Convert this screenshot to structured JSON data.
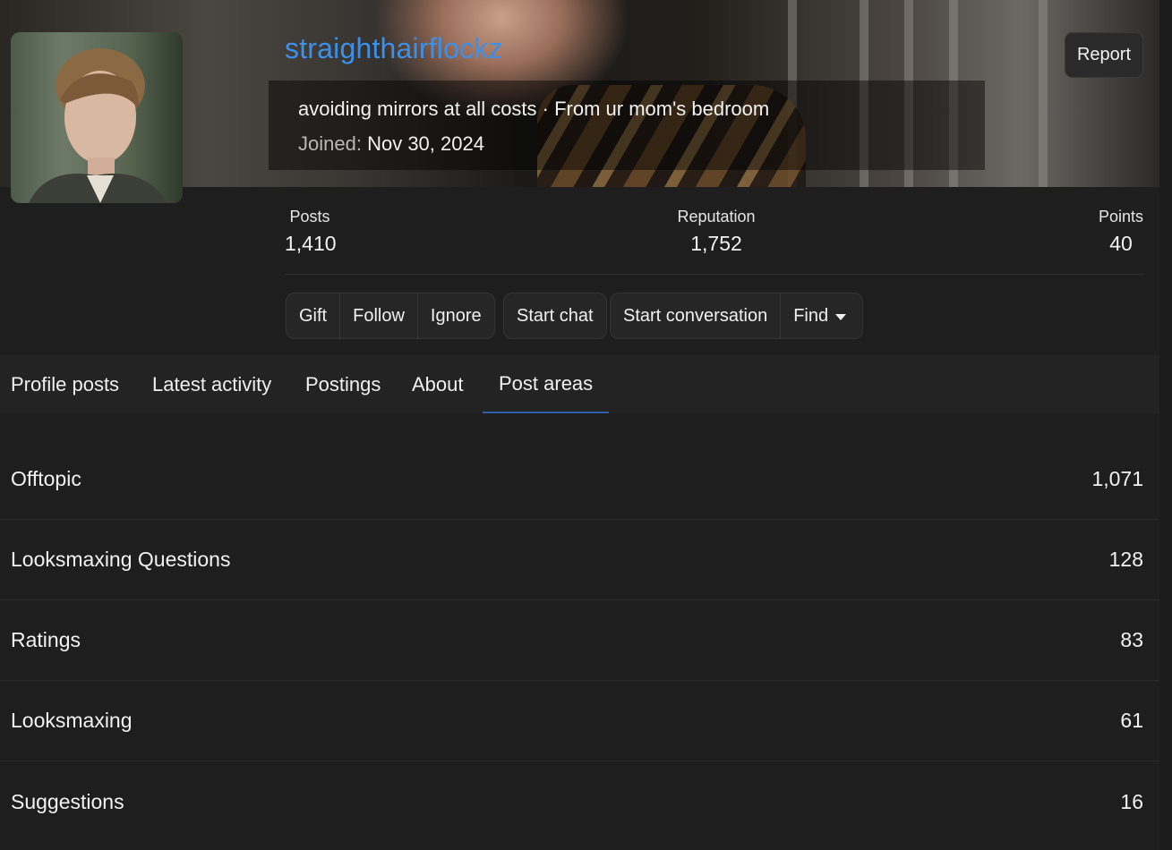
{
  "profile": {
    "username": "straighthairflockz",
    "tagline": "avoiding mirrors at all costs · From ur mom's bedroom",
    "joined_label": "Joined:",
    "joined_date": "Nov 30, 2024",
    "report_label": "Report"
  },
  "stats": {
    "posts": {
      "label": "Posts",
      "value": "1,410"
    },
    "reputation": {
      "label": "Reputation",
      "value": "1,752"
    },
    "points": {
      "label": "Points",
      "value": "40"
    }
  },
  "actions": {
    "gift": "Gift",
    "follow": "Follow",
    "ignore": "Ignore",
    "start_chat": "Start chat",
    "start_conversation": "Start conversation",
    "find": "Find"
  },
  "tabs": [
    {
      "label": "Profile posts"
    },
    {
      "label": "Latest activity"
    },
    {
      "label": "Postings"
    },
    {
      "label": "About"
    },
    {
      "label": "Post areas",
      "active": true
    }
  ],
  "post_areas": [
    {
      "name": "Offtopic",
      "count": "1,071"
    },
    {
      "name": "Looksmaxing Questions",
      "count": "128"
    },
    {
      "name": "Ratings",
      "count": "83"
    },
    {
      "name": "Looksmaxing",
      "count": "61"
    },
    {
      "name": "Suggestions",
      "count": "16"
    }
  ],
  "colors": {
    "username": "#3d8fe8",
    "active_tab_underline": "#2f5ea8",
    "background": "#1e1e1e"
  }
}
